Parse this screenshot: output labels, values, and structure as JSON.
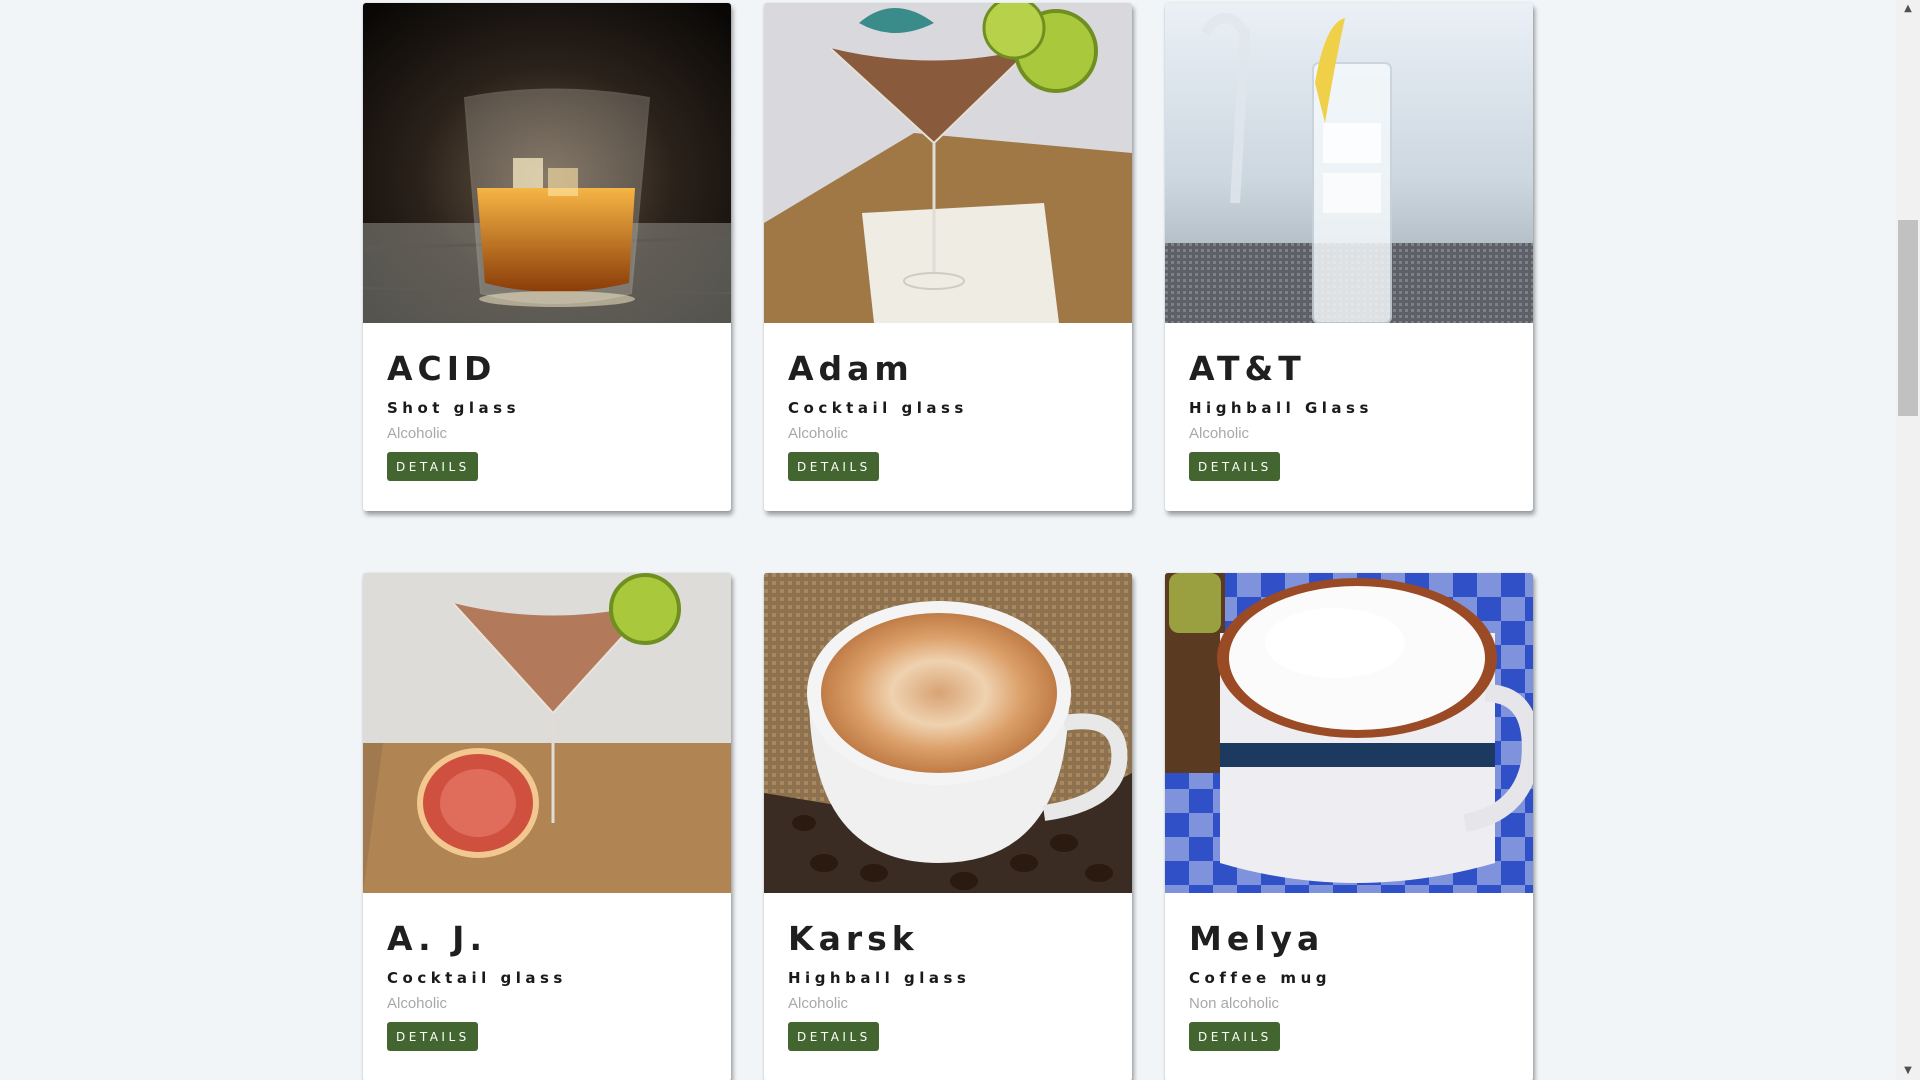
{
  "drinks": [
    {
      "name": "ACID",
      "glass": "Shot glass",
      "alcoholic": "Alcoholic",
      "button": "DETAILS",
      "image": "whiskey-on-rocks-photo"
    },
    {
      "name": "Adam",
      "glass": "Cocktail glass",
      "alcoholic": "Alcoholic",
      "button": "DETAILS",
      "image": "martini-with-lime-photo"
    },
    {
      "name": "AT&T",
      "glass": "Highball Glass",
      "alcoholic": "Alcoholic",
      "button": "DETAILS",
      "image": "highball-with-lemon-photo"
    },
    {
      "name": "A. J.",
      "glass": "Cocktail glass",
      "alcoholic": "Alcoholic",
      "button": "DETAILS",
      "image": "grapefruit-cocktail-photo"
    },
    {
      "name": "Karsk",
      "glass": "Highball glass",
      "alcoholic": "Alcoholic",
      "button": "DETAILS",
      "image": "coffee-cup-with-beans-photo"
    },
    {
      "name": "Melya",
      "glass": "Coffee mug",
      "alcoholic": "Non alcoholic",
      "button": "DETAILS",
      "image": "cappuccino-mug-photo"
    }
  ],
  "colors": {
    "background": "#f1f5f8",
    "button": "#436630",
    "muted_text": "#a8a8a8"
  },
  "scrollbar": {
    "up_icon": "triangle-up-icon",
    "down_icon": "triangle-down-icon"
  }
}
